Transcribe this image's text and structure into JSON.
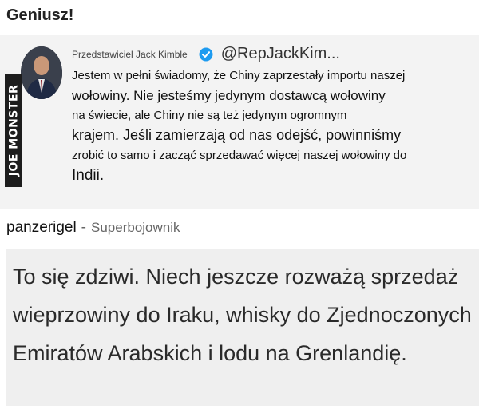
{
  "post": {
    "title": "Geniusz!"
  },
  "tweet": {
    "name": "Przedstawiciel Jack Kimble",
    "handle": "@RepJackKim...",
    "watermark": "JOE MONSTER",
    "lines": [
      "Jestem w pełni świadomy, że Chiny zaprzestały importu naszej",
      "wołowiny. Nie jesteśmy jedynym dostawcą wołowiny",
      "na świecie, ale Chiny nie są też jedynym ogromnym",
      "krajem. Jeśli zamierzają od nas odejść, powinniśmy",
      "zrobić to samo i zacząć sprzedawać więcej naszej wołowiny do",
      "Indii."
    ],
    "verified_color": "#1d9bf0"
  },
  "comment": {
    "username": "panzerigel",
    "separator": "-",
    "rank": "Superbojownik",
    "text": "To się zdziwi. Niech jeszcze rozważą sprzedaż wieprzowiny do Iraku, whisky do Zjednoczonych Emiratów Arabskich i lodu na Grenlandię."
  }
}
